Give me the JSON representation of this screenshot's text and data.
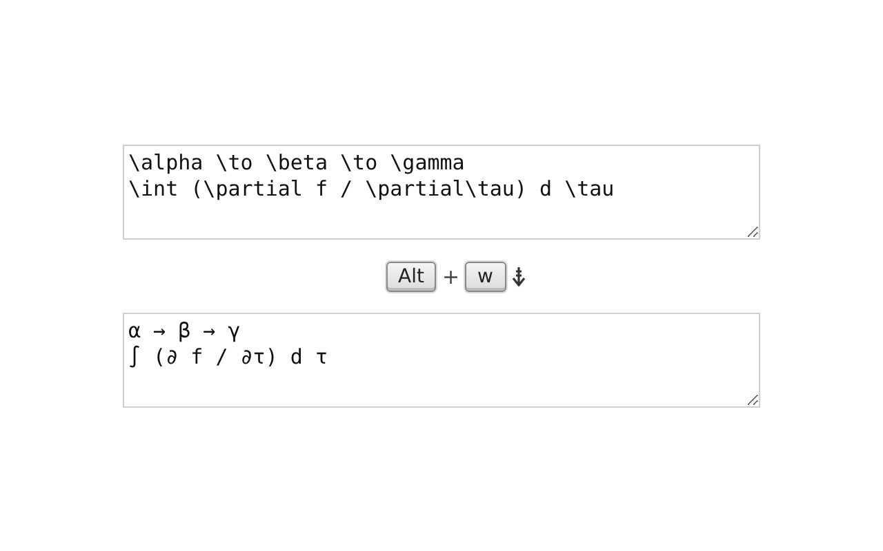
{
  "input": {
    "lines": [
      "\\alpha \\to \\beta \\to \\gamma",
      "\\int (\\partial f / \\partial\\tau) d \\tau"
    ]
  },
  "shortcut": {
    "keys": [
      "Alt",
      "w"
    ],
    "joiner": "+"
  },
  "output": {
    "lines": [
      "α → β → γ",
      "∫ (∂ f / ∂τ) d τ"
    ]
  }
}
